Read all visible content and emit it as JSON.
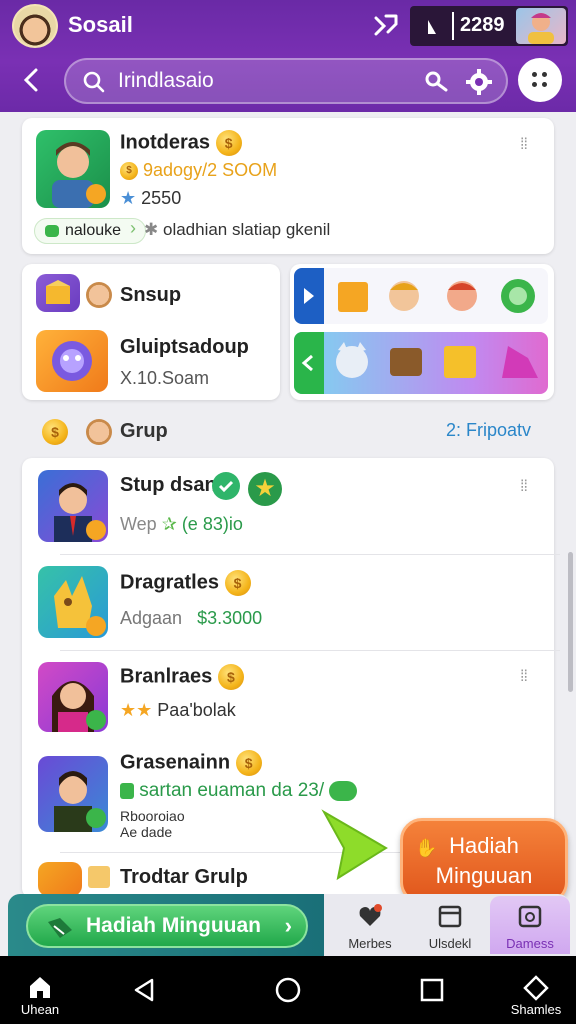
{
  "header": {
    "app_name": "Sosail",
    "score": "2289",
    "search_value": "Irindlasaio"
  },
  "featured": {
    "name": "Inotderas",
    "stat": "9adogy/2 SOOM",
    "rating": "2550",
    "tag": "nalouke",
    "note": "oladhian slatiap gkenil"
  },
  "mini_cards": [
    {
      "title": "Snsup"
    },
    {
      "title": "Gluiptsadoup",
      "sub": "X.10.Soam"
    }
  ],
  "section": {
    "title": "Grup",
    "count": "2:",
    "link": "Fripoatv"
  },
  "list": [
    {
      "title": "Stup dsan",
      "sub": "Wep",
      "extra": "(e 83)io"
    },
    {
      "title": "Dragratles",
      "sub": "Adgaan",
      "price": "$3.3000"
    },
    {
      "title": "Branlraes",
      "sub": "Paa'bolak"
    },
    {
      "title": "Grasenainn",
      "sub": "sartan euaman da 23/",
      "line3": "Rbooroiao",
      "line4": "Ae dade"
    },
    {
      "title": "Trodtar Grulp"
    }
  ],
  "bottom_bar": {
    "cta": "Hadiah Minguuan",
    "tabs": [
      "Merbes",
      "Ulsdekl",
      "Damess"
    ]
  },
  "floating_button": {
    "line1": "Hadiah",
    "line2": "Minguuan"
  },
  "system_nav": {
    "home_label": "Uhean",
    "menu_label": "Shamles"
  },
  "colors": {
    "header": "#6a2aa6",
    "accent_green": "#21a84a",
    "accent_orange": "#e0561c",
    "link_blue": "#2a86c9"
  }
}
